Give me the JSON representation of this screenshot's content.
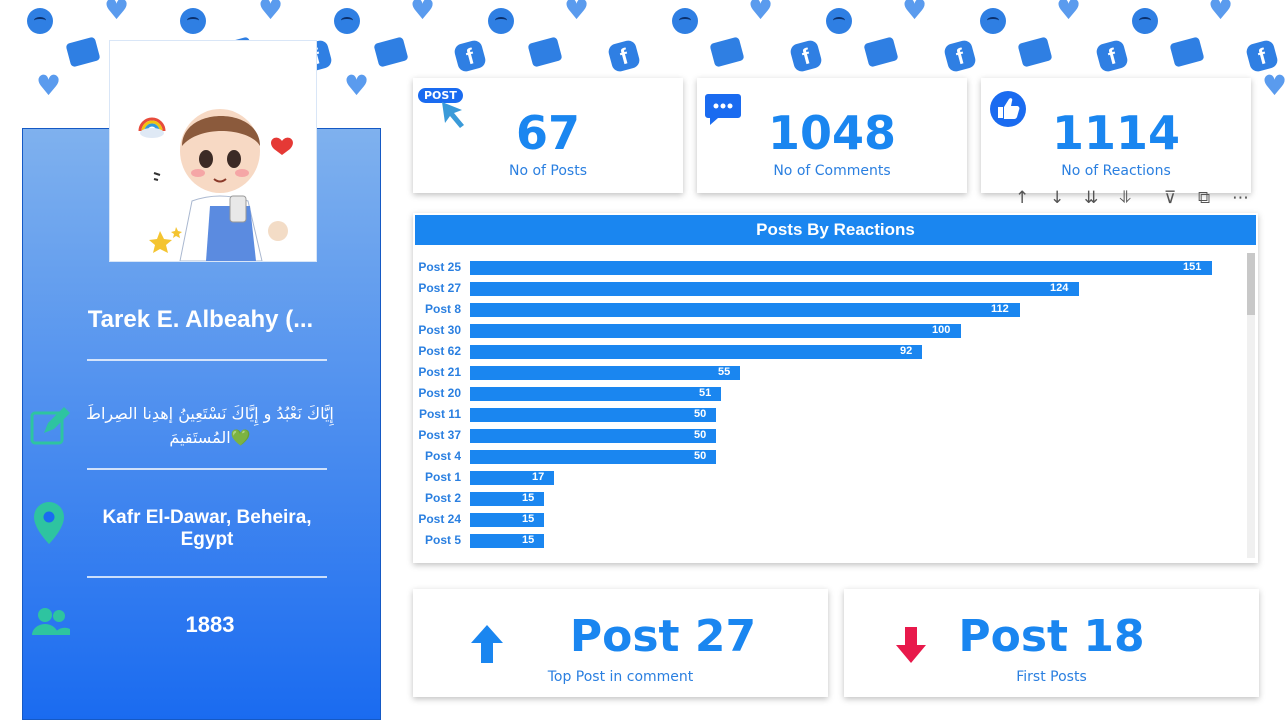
{
  "profile": {
    "name": "Tarek E. Albeahy  (...",
    "bio": "إِيَّاكَ نَعْبُدُ و إِيَّاكَ نَسْتَعِينُ إهدِنا الصِراطَ المُستَقيمَ",
    "heart_emoji": "💚",
    "location": "Kafr El-Dawar, Beheira, Egypt",
    "followers": "1883"
  },
  "kpis": [
    {
      "value": "67",
      "label": "No of Posts",
      "icon": "post-cursor-icon",
      "badge": "POST"
    },
    {
      "value": "1048",
      "label": "No of Comments",
      "icon": "comment-bubble-icon"
    },
    {
      "value": "1114",
      "label": "No of Reactions",
      "icon": "thumbs-up-icon"
    }
  ],
  "chart_data": {
    "type": "bar",
    "orientation": "horizontal",
    "title": "Posts By Reactions",
    "categories": [
      "Post 25",
      "Post 27",
      "Post 8",
      "Post 30",
      "Post 62",
      "Post 21",
      "Post 20",
      "Post 11",
      "Post 37",
      "Post 4",
      "Post 1",
      "Post 2",
      "Post 24",
      "Post 5"
    ],
    "values": [
      151,
      124,
      112,
      100,
      92,
      55,
      51,
      50,
      50,
      50,
      17,
      15,
      15,
      15
    ],
    "data_labels": true,
    "scrollable": true
  },
  "bottom_cards": [
    {
      "value": "Post 27",
      "label": "Top Post in comment",
      "icon": "arrow-up-icon",
      "color": "#1a86f0"
    },
    {
      "value": "Post 18",
      "label": "First Posts",
      "icon": "arrow-down-icon",
      "color": "#e8194b"
    }
  ],
  "toolbar_icons": [
    "sort-up-icon",
    "sort-down-icon",
    "expand-down-icon",
    "drill-icon",
    "filter-icon",
    "focus-mode-icon",
    "more-options-icon"
  ],
  "colors": {
    "accent": "#1a86f0",
    "panel_top": "#7fb1ee",
    "panel_bottom": "#1a6bf0",
    "icon_green": "#2ec4a0",
    "down_red": "#e8194b"
  }
}
